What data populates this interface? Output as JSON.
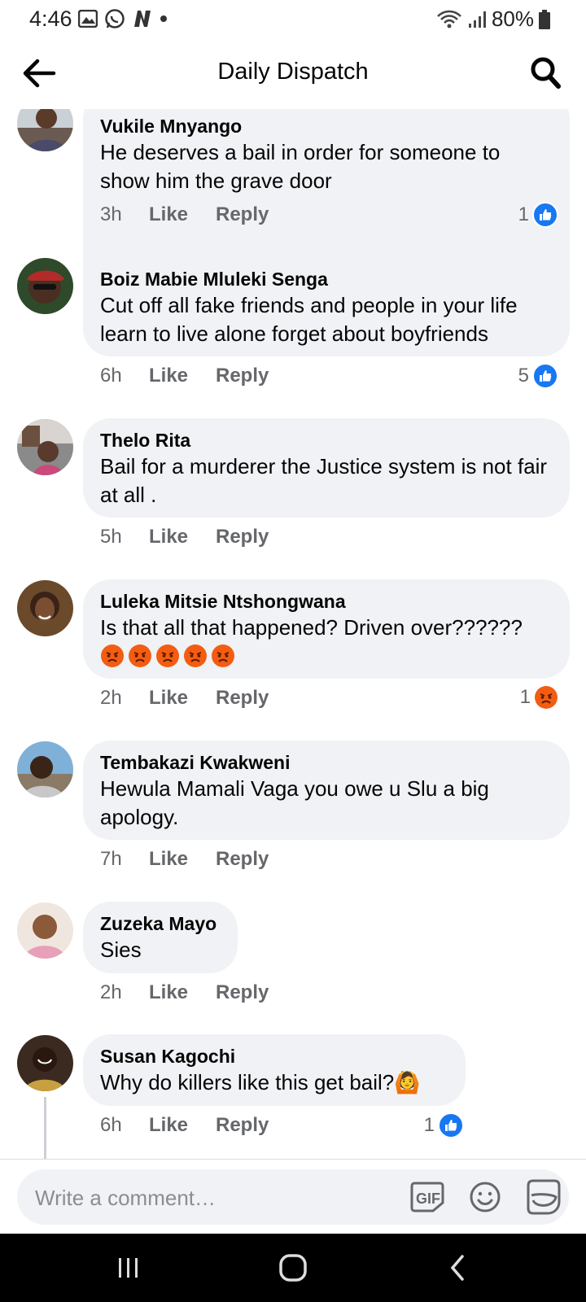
{
  "status_bar": {
    "time": "4:46",
    "battery": "80%",
    "left_icons": [
      "gallery-icon",
      "whatsapp-icon",
      "n-app-icon",
      "dot-icon"
    ],
    "right_icons": [
      "wifi-icon",
      "signal-icon",
      "battery-icon"
    ]
  },
  "header": {
    "title": "Daily Dispatch",
    "back_icon": "back-arrow-icon",
    "search_icon": "search-icon"
  },
  "actions": {
    "like_label": "Like",
    "reply_label": "Reply"
  },
  "comments": [
    {
      "author": "Vukile Mnyango",
      "text": "He deserves a bail in order for someone to show him the grave door",
      "time": "3h",
      "reaction_count": "1",
      "reaction": "like"
    },
    {
      "author": "Boiz Mabie Mluleki Senga",
      "text": "Cut off all fake friends and people in your life learn to live alone forget about boyfriends",
      "time": "6h",
      "reaction_count": "5",
      "reaction": "like"
    },
    {
      "author": "Thelo Rita",
      "text": "Bail for a murderer the Justice system is not fair at all .",
      "time": "5h",
      "reaction_count": "",
      "reaction": ""
    },
    {
      "author": "Luleka Mitsie Ntshongwana",
      "text": "Is that all that happened? Driven over??????",
      "emoji_count": 5,
      "emoji": "angry-face",
      "time": "2h",
      "reaction_count": "1",
      "reaction": "angry"
    },
    {
      "author": "Tembakazi Kwakweni",
      "text": "Hewula Mamali Vaga you owe u Slu a big apology.",
      "time": "7h",
      "reaction_count": "",
      "reaction": ""
    },
    {
      "author": "Zuzeka Mayo",
      "text": "Sies",
      "time": "2h",
      "reaction_count": "",
      "reaction": ""
    },
    {
      "author": "Susan Kagochi",
      "text": "Why do killers like this get bail?🙆",
      "time": "6h",
      "reaction_count": "1",
      "reaction": "like"
    }
  ],
  "composer": {
    "placeholder": "Write a comment…",
    "gif_label": "GIF",
    "emoji_icon": "smiley-icon",
    "sticker_icon": "sticker-icon"
  },
  "nav_bar": {
    "icons": [
      "recent-apps-icon",
      "home-icon",
      "back-icon"
    ]
  },
  "colors": {
    "bubble": "#f0f2f5",
    "like_blue": "#1877f2",
    "secondary_text": "#65676b",
    "angry": "#f25d12"
  }
}
